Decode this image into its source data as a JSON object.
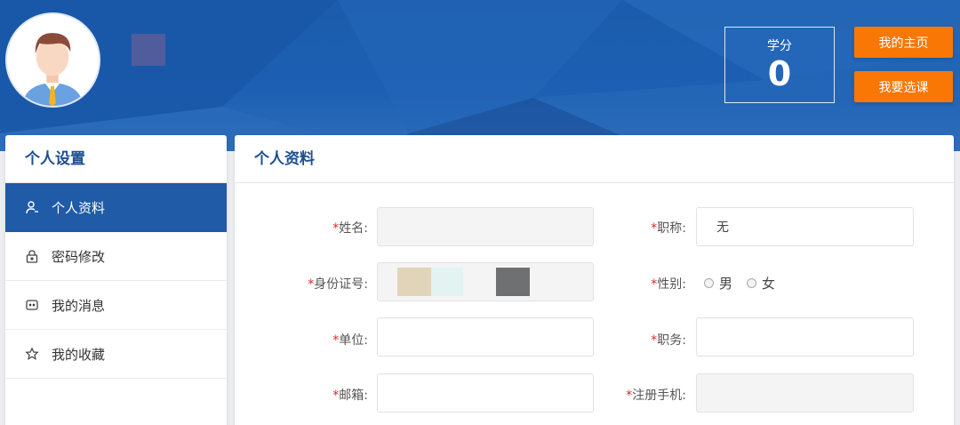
{
  "header": {
    "credit_label": "学分",
    "credit_value": "0",
    "my_home_label": "我的主页",
    "select_course_label": "我要选课",
    "accent_color": "#f87705",
    "banner_color": "#1d5fb2"
  },
  "sidebar": {
    "title": "个人设置",
    "items": [
      {
        "label": "个人资料",
        "icon": "user-icon",
        "active": true
      },
      {
        "label": "密码修改",
        "icon": "lock-icon",
        "active": false
      },
      {
        "label": "我的消息",
        "icon": "message-icon",
        "active": false
      },
      {
        "label": "我的收藏",
        "icon": "star-icon",
        "active": false
      }
    ]
  },
  "profile": {
    "title": "个人资料",
    "fields": {
      "name": {
        "label": "姓名:",
        "value": ""
      },
      "title": {
        "label": "职称:",
        "value": "无"
      },
      "id_card": {
        "label": "身份证号:",
        "value": ""
      },
      "gender": {
        "label": "性别:",
        "options": [
          "男",
          "女"
        ],
        "selected": null
      },
      "unit": {
        "label": "单位:",
        "value": ""
      },
      "position": {
        "label": "职务:",
        "value": ""
      },
      "email": {
        "label": "邮箱:",
        "value": ""
      },
      "phone": {
        "label": "注册手机:",
        "value": ""
      }
    },
    "required_mark": "*"
  }
}
